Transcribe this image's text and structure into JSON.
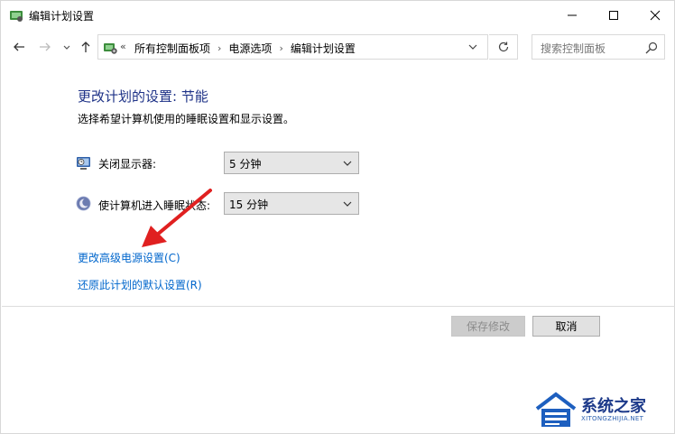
{
  "window": {
    "title": "编辑计划设置"
  },
  "address": {
    "prefix": "«",
    "crumbs": [
      "所有控制面板项",
      "电源选项",
      "编辑计划设置"
    ],
    "separator": "›"
  },
  "search": {
    "placeholder": "搜索控制面板"
  },
  "content": {
    "heading": "更改计划的设置: 节能",
    "subtext": "选择希望计算机使用的睡眠设置和显示设置。",
    "display_off": {
      "label": "关闭显示器:",
      "value": "5 分钟"
    },
    "sleep": {
      "label": "使计算机进入睡眠状态:",
      "value": "15 分钟"
    },
    "advanced_link": "更改高级电源设置(C)",
    "restore_link": "还原此计划的默认设置(R)"
  },
  "buttons": {
    "save": "保存修改",
    "cancel": "取消"
  },
  "watermark": {
    "name": "系统之家",
    "url": "XITONGZHIJIA.NET"
  },
  "colors": {
    "heading": "#1e3287",
    "link": "#0066cc",
    "annotation_arrow": "#e02020"
  }
}
